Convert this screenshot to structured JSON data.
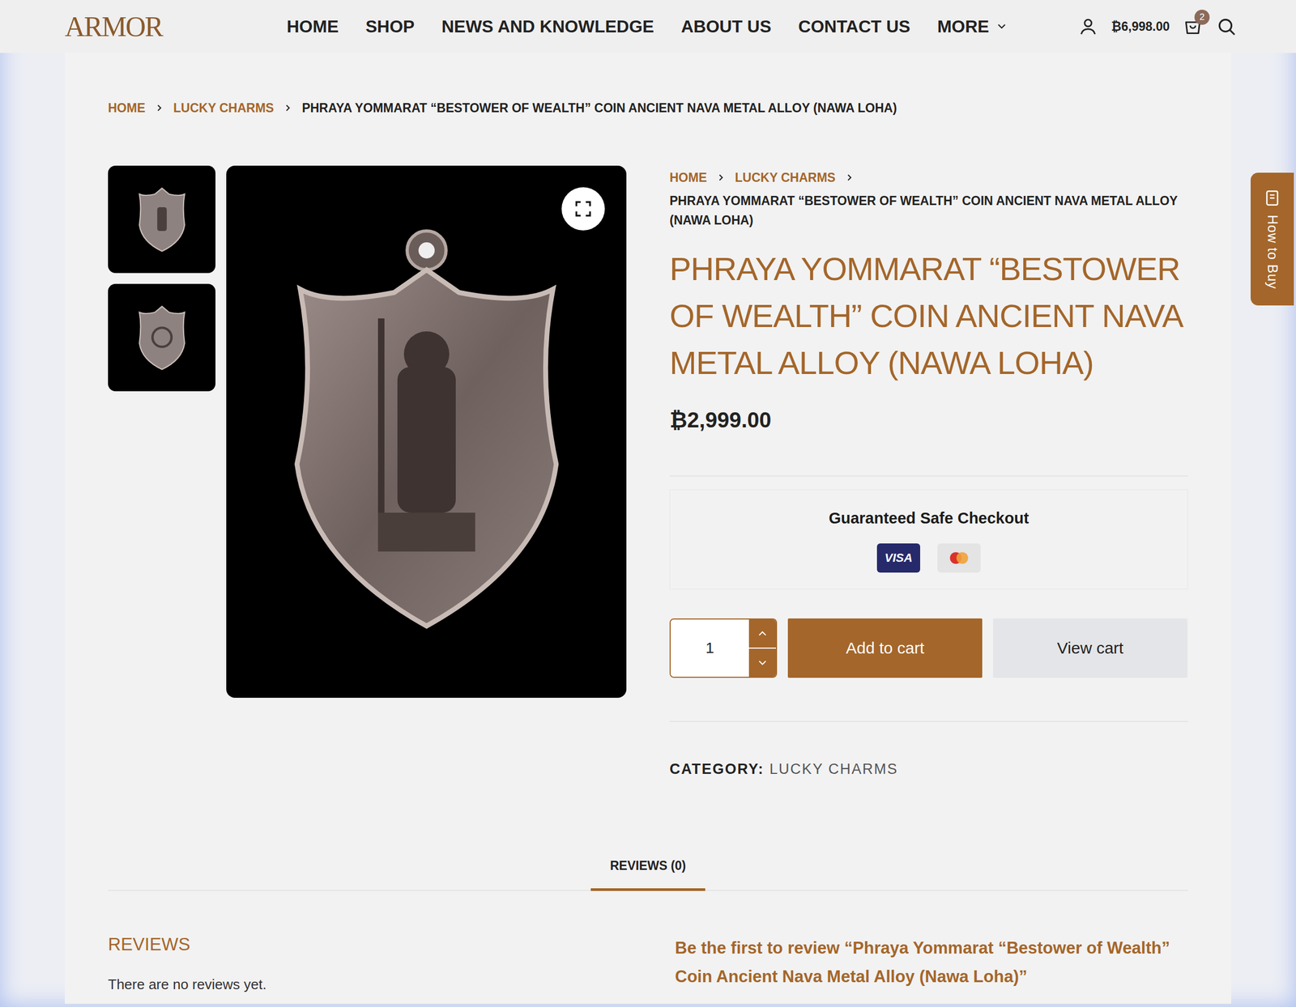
{
  "logo": "ARMOR",
  "nav": [
    {
      "label": "HOME",
      "dropdown": false
    },
    {
      "label": "SHOP",
      "dropdown": false
    },
    {
      "label": "NEWS AND KNOWLEDGE",
      "dropdown": false
    },
    {
      "label": "ABOUT US",
      "dropdown": false
    },
    {
      "label": "CONTACT US",
      "dropdown": false
    },
    {
      "label": "MORE",
      "dropdown": true
    }
  ],
  "cart": {
    "total": "₿6,998.00",
    "count": "2"
  },
  "breadcrumb": [
    "HOME",
    "LUCKY CHARMS",
    "PHRAYA YOMMARAT “BESTOWER OF WEALTH” COIN ANCIENT NAVA METAL ALLOY (NAWA LOHA)"
  ],
  "gallery": {
    "thumbnails": [
      {
        "kind": "front"
      },
      {
        "kind": "back"
      }
    ]
  },
  "product": {
    "title": "PHRAYA YOMMARAT “BESTOWER OF WEALTH” COIN ANCIENT NAVA METAL ALLOY (NAWA LOHA)",
    "price": "₿2,999.00"
  },
  "checkout": {
    "title": "Guaranteed Safe Checkout",
    "visa_label": "VISA"
  },
  "quantity": "1",
  "buttons": {
    "add": "Add to cart",
    "view": "View cart"
  },
  "category": {
    "label": "CATEGORY:",
    "value": "LUCKY CHARMS"
  },
  "tabs": [
    {
      "label": "REVIEWS (0)",
      "selected": true
    }
  ],
  "reviews": {
    "heading": "REVIEWS",
    "empty": "There are no reviews yet.",
    "prompt": "Be the first to review “Phraya Yommarat “Bestower of Wealth” Coin Ancient Nava Metal Alloy (Nawa Loha)”"
  },
  "side_tab": "How to Buy"
}
